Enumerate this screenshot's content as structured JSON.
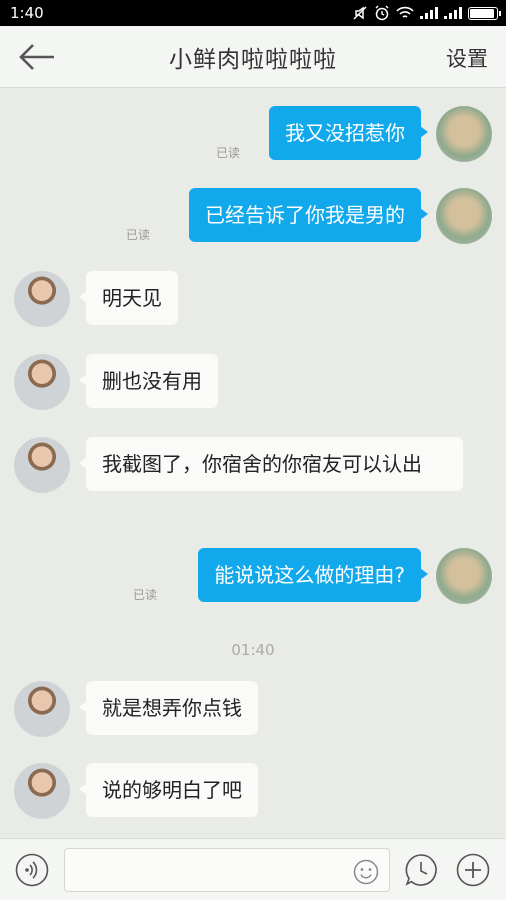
{
  "status_bar": {
    "time": "1:40"
  },
  "header": {
    "title": "小鲜肉啦啦啦啦",
    "settings_label": "设置"
  },
  "messages": [
    {
      "sender": "self",
      "text": "我又没招惹你",
      "read_label": "已读"
    },
    {
      "sender": "self",
      "text": "已经告诉了你我是男的",
      "read_label": "已读"
    },
    {
      "sender": "other",
      "text": "明天见"
    },
    {
      "sender": "other",
      "text": "删也没有用"
    },
    {
      "sender": "other",
      "text": "我截图了，你宿舍的你宿友可以认出"
    },
    {
      "sender": "self",
      "text": "能说说这么做的理由?",
      "read_label": "已读"
    },
    {
      "sender": "other",
      "text": "就是想弄你点钱"
    },
    {
      "sender": "other",
      "text": "说的够明白了吧"
    }
  ],
  "timestamp": "01:40",
  "input": {
    "value": "",
    "placeholder": ""
  },
  "icons": {
    "back": "back-arrow-icon",
    "voice": "voice-icon",
    "emoji": "emoji-icon",
    "clock": "clock-icon",
    "add": "plus-icon"
  },
  "colors": {
    "self_bubble": "#12a8ec",
    "other_bubble": "#fafbf9",
    "background": "#e9ebe7"
  }
}
